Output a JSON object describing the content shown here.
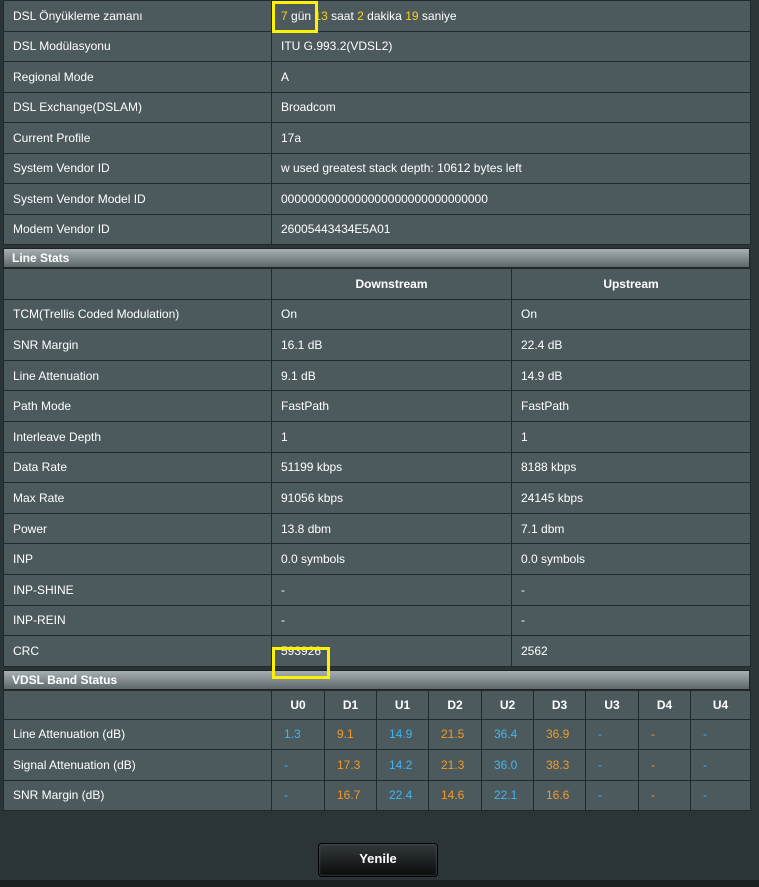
{
  "info": {
    "rows": [
      {
        "label": "DSL Önyükleme zamanı",
        "value": ""
      },
      {
        "label": "DSL Modülasyonu",
        "value": "ITU G.993.2(VDSL2)"
      },
      {
        "label": "Regional Mode",
        "value": "A"
      },
      {
        "label": "DSL Exchange(DSLAM)",
        "value": "Broadcom"
      },
      {
        "label": "Current Profile",
        "value": "17a"
      },
      {
        "label": "System Vendor ID",
        "value": "w used greatest stack depth: 10612 bytes left"
      },
      {
        "label": "System Vendor Model ID",
        "value": "0000000000000000000000000000000"
      },
      {
        "label": "Modem Vendor ID",
        "value": "26005443434E5A01"
      }
    ],
    "uptime": {
      "days": "7",
      "days_unit": "gün",
      "hours": "13",
      "hours_unit": "saat",
      "minutes": "2",
      "minutes_unit": "dakika",
      "seconds": "19",
      "seconds_unit": "saniye"
    }
  },
  "line_stats": {
    "title": "Line Stats",
    "columns": [
      "Downstream",
      "Upstream"
    ],
    "rows": [
      {
        "label": "TCM(Trellis Coded Modulation)",
        "down": "On",
        "up": "On"
      },
      {
        "label": "SNR Margin",
        "down": "16.1 dB",
        "up": "22.4 dB"
      },
      {
        "label": "Line Attenuation",
        "down": "9.1 dB",
        "up": "14.9 dB"
      },
      {
        "label": "Path Mode",
        "down": "FastPath",
        "up": "FastPath"
      },
      {
        "label": "Interleave Depth",
        "down": "1",
        "up": "1"
      },
      {
        "label": "Data Rate",
        "down": "51199 kbps",
        "up": "8188 kbps"
      },
      {
        "label": "Max Rate",
        "down": "91056 kbps",
        "up": "24145 kbps"
      },
      {
        "label": "Power",
        "down": "13.8 dbm",
        "up": "7.1 dbm"
      },
      {
        "label": "INP",
        "down": "0.0 symbols",
        "up": "0.0 symbols"
      },
      {
        "label": "INP-SHINE",
        "down": "-",
        "up": "-"
      },
      {
        "label": "INP-REIN",
        "down": "-",
        "up": "-"
      },
      {
        "label": "CRC",
        "down": "593926",
        "up": "2562"
      }
    ]
  },
  "band_status": {
    "title": "VDSL Band Status",
    "bands": [
      "U0",
      "D1",
      "U1",
      "D2",
      "U2",
      "D3",
      "U3",
      "D4",
      "U4"
    ],
    "rows": [
      {
        "label": "Line Attenuation (dB)",
        "values": [
          "1.3",
          "9.1",
          "14.9",
          "21.5",
          "36.4",
          "36.9",
          "-",
          "-",
          "-"
        ]
      },
      {
        "label": "Signal Attenuation (dB)",
        "values": [
          "-",
          "17.3",
          "14.2",
          "21.3",
          "36.0",
          "38.3",
          "-",
          "-",
          "-"
        ]
      },
      {
        "label": "SNR Margin (dB)",
        "values": [
          "-",
          "16.7",
          "22.4",
          "14.6",
          "22.1",
          "16.6",
          "-",
          "-",
          "-"
        ]
      }
    ]
  },
  "refresh_label": "Yenile",
  "colors": {
    "upstream_band": "#42b4ef",
    "downstream_band": "#f09a28",
    "uptime_number": "#f7cf29",
    "highlight": "#fff200"
  }
}
